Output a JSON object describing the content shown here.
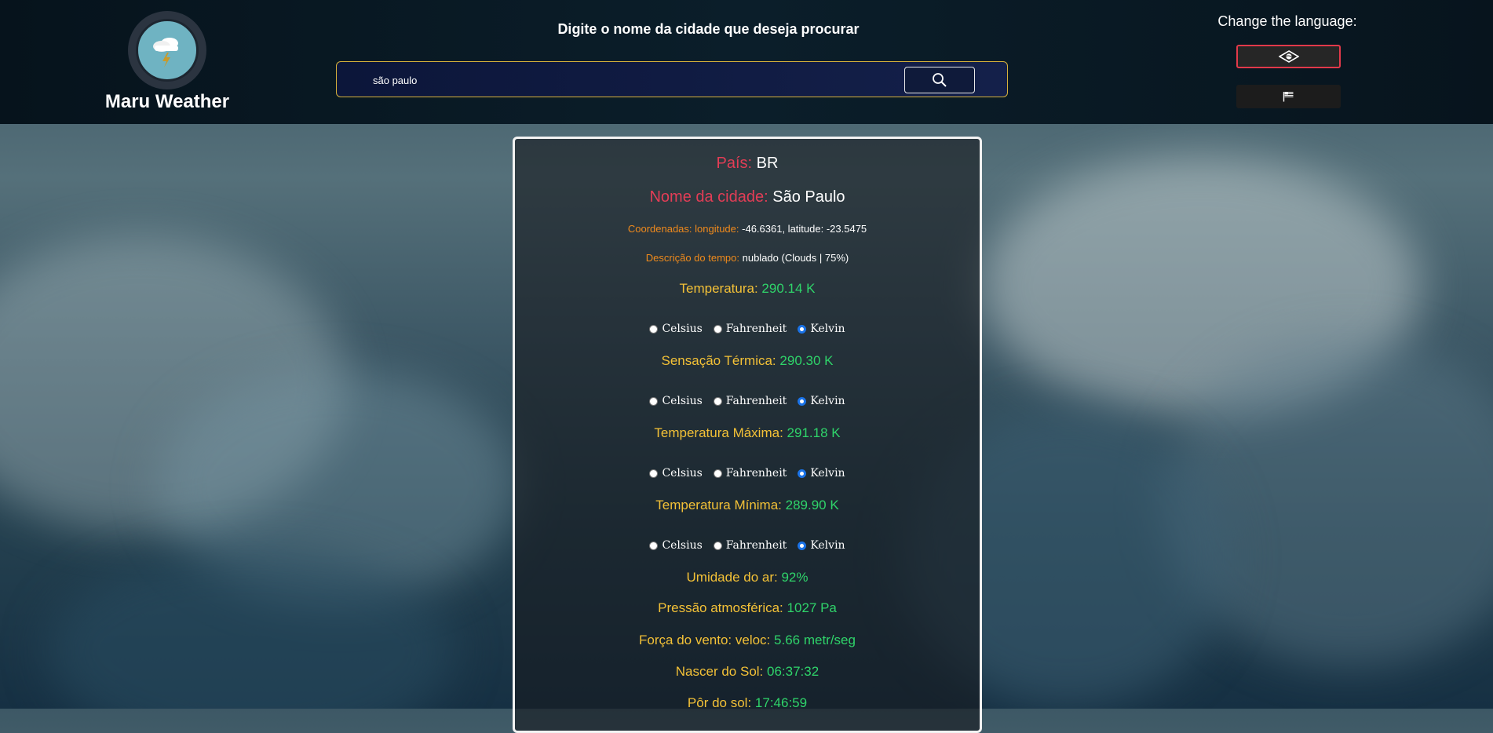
{
  "brand": {
    "title": "Maru Weather"
  },
  "search": {
    "prompt": "Digite o nome da cidade que deseja procurar",
    "value": "são paulo"
  },
  "language": {
    "label": "Change the language:",
    "options": [
      "brazil-flag-icon",
      "usa-flag-icon"
    ],
    "selected": "brazil-flag-icon"
  },
  "weather": {
    "country": {
      "label": "País:",
      "value": "BR"
    },
    "city": {
      "label": "Nome da cidade:",
      "value": "São Paulo"
    },
    "coords": {
      "label": "Coordenadas: longitude:",
      "value": "-46.6361, latitude: -23.5475"
    },
    "description": {
      "label": "Descrição do tempo:",
      "value": "nublado (Clouds | 75%)"
    },
    "temperature": {
      "label": "Temperatura:",
      "value": "290.14 K"
    },
    "feels_like": {
      "label": "Sensação Térmica:",
      "value": "290.30 K"
    },
    "temp_max": {
      "label": "Temperatura Máxima:",
      "value": "291.18 K"
    },
    "temp_min": {
      "label": "Temperatura Mínima:",
      "value": "289.90 K"
    },
    "humidity": {
      "label": "Umidade do ar:",
      "value": "92%"
    },
    "pressure": {
      "label": "Pressão atmosférica:",
      "value": "1027 Pa"
    },
    "wind": {
      "label": "Força do vento: veloc:",
      "value": "5.66 metr/seg"
    },
    "sunrise": {
      "label": "Nascer do Sol:",
      "value": "06:37:32"
    },
    "sunset": {
      "label": "Pôr do sol:",
      "value": "17:46:59"
    }
  },
  "units": {
    "celsius": "Celsius",
    "fahrenheit": "Fahrenheit",
    "kelvin": "Kelvin",
    "selected": "Kelvin"
  },
  "colors": {
    "label_red": "#e33d56",
    "label_orange": "#f08a1c",
    "label_yellow": "#f3c137",
    "value_green": "#2fd46a",
    "search_border": "#d6b13b"
  }
}
